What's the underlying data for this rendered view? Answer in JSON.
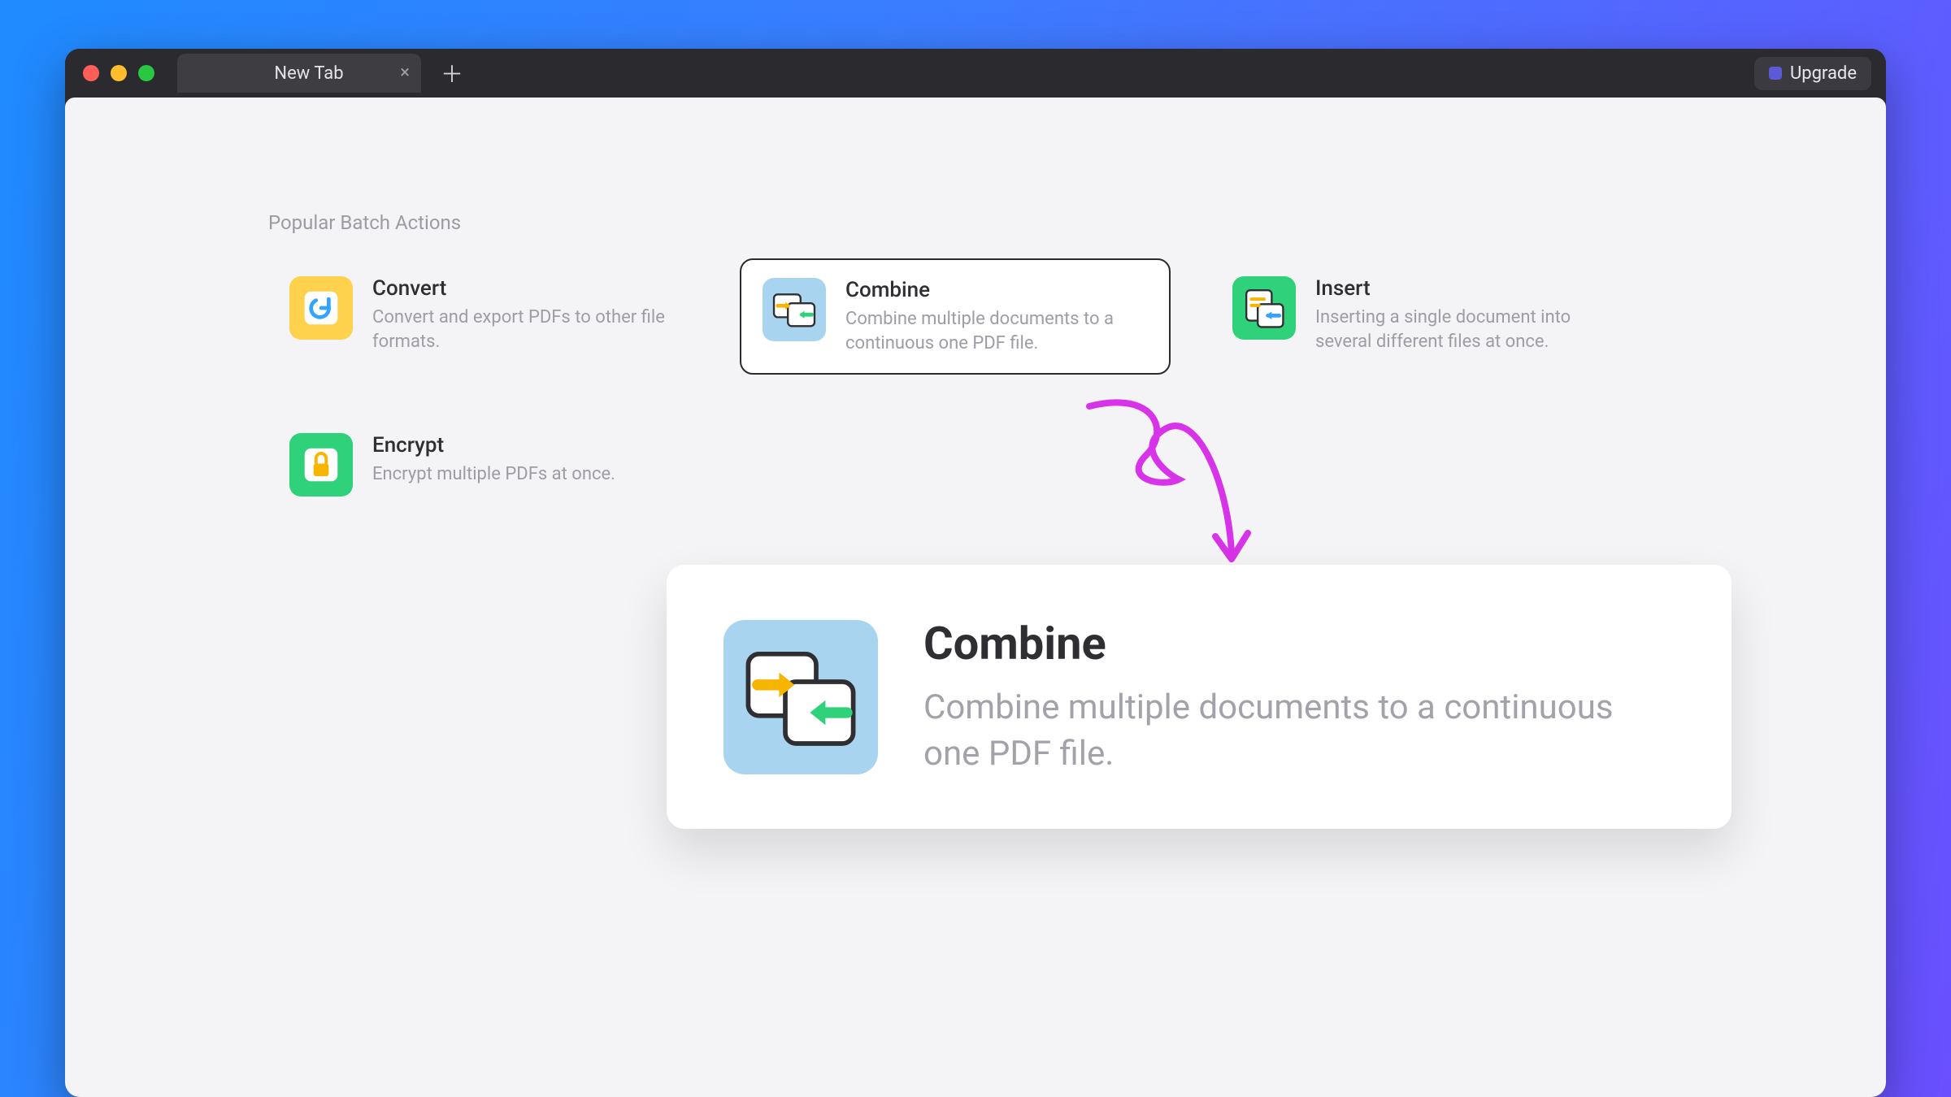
{
  "window": {
    "tab_label": "New Tab",
    "upgrade_label": "Upgrade"
  },
  "section": {
    "title": "Popular Batch Actions"
  },
  "cards": {
    "convert": {
      "title": "Convert",
      "desc": "Convert and export PDFs to other file formats."
    },
    "combine": {
      "title": "Combine",
      "desc": "Combine multiple documents to a continuous one PDF file."
    },
    "insert": {
      "title": "Insert",
      "desc": "Inserting a single document into several different files at once."
    },
    "encrypt": {
      "title": "Encrypt",
      "desc": "Encrypt multiple PDFs at once."
    }
  },
  "callout": {
    "title": "Combine",
    "desc": "Combine multiple documents to a continuous one PDF file."
  },
  "colors": {
    "accent_yellow": "#ffd24d",
    "accent_blue": "#a9d4ef",
    "accent_green": "#2fd17a",
    "annotation": "#d733e8"
  }
}
